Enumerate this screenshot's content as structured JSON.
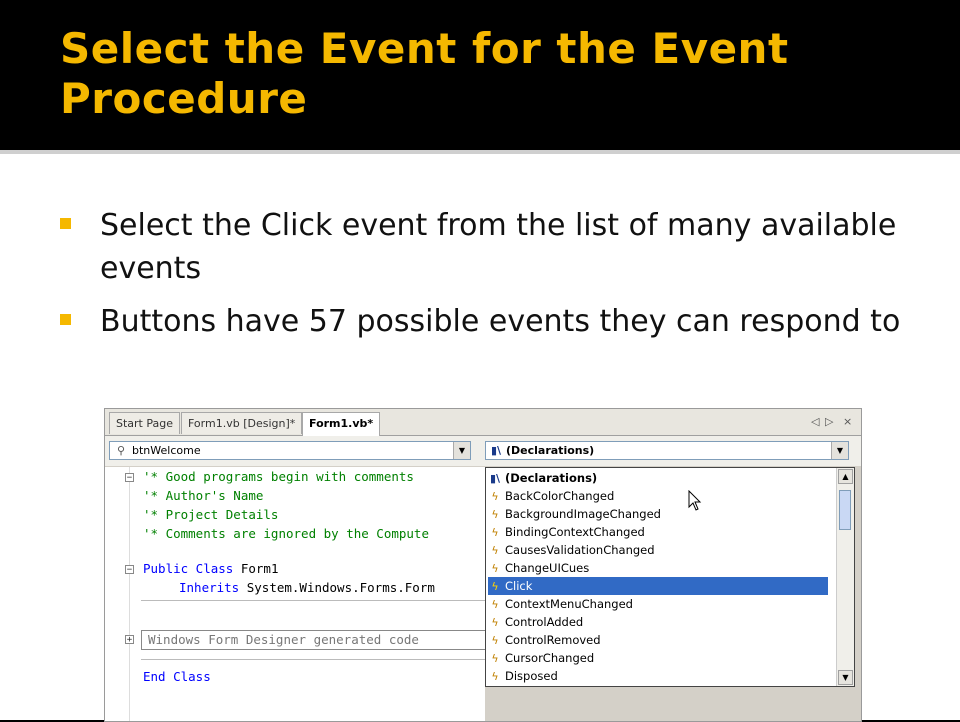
{
  "slide": {
    "title": "Select the Event for the Event Procedure",
    "bullets": [
      "Select the Click event from the list of many available events",
      "Buttons have 57 possible events they can respond to"
    ]
  },
  "ide": {
    "tabs": [
      "Start Page",
      "Form1.vb [Design]*",
      "Form1.vb*"
    ],
    "active_tab": "Form1.vb*",
    "tab_controls": [
      "◁",
      "▷",
      "×"
    ],
    "object_combo": "btnWelcome",
    "event_combo": "(Declarations)",
    "code": {
      "l1": "'* Good programs begin with comments",
      "l2": "'* Author's Name",
      "l3": "'* Project Details",
      "l4": "'* Comments are ignored by the Compute",
      "l5_kw": "Public Class",
      "l5_rest": " Form1",
      "l6_kw": "Inherits",
      "l6_rest": " System.Windows.Forms.Form",
      "region": "Windows Form Designer generated code",
      "l8": "End Class"
    },
    "events": [
      "(Declarations)",
      "BackColorChanged",
      "BackgroundImageChanged",
      "BindingContextChanged",
      "CausesValidationChanged",
      "ChangeUICues",
      "Click",
      "ContextMenuChanged",
      "ControlAdded",
      "ControlRemoved",
      "CursorChanged",
      "Disposed"
    ],
    "selected_event": "Click"
  },
  "colors": {
    "title": "#F5B800",
    "bullet": "#F5B800",
    "selection": "#316ac5"
  }
}
